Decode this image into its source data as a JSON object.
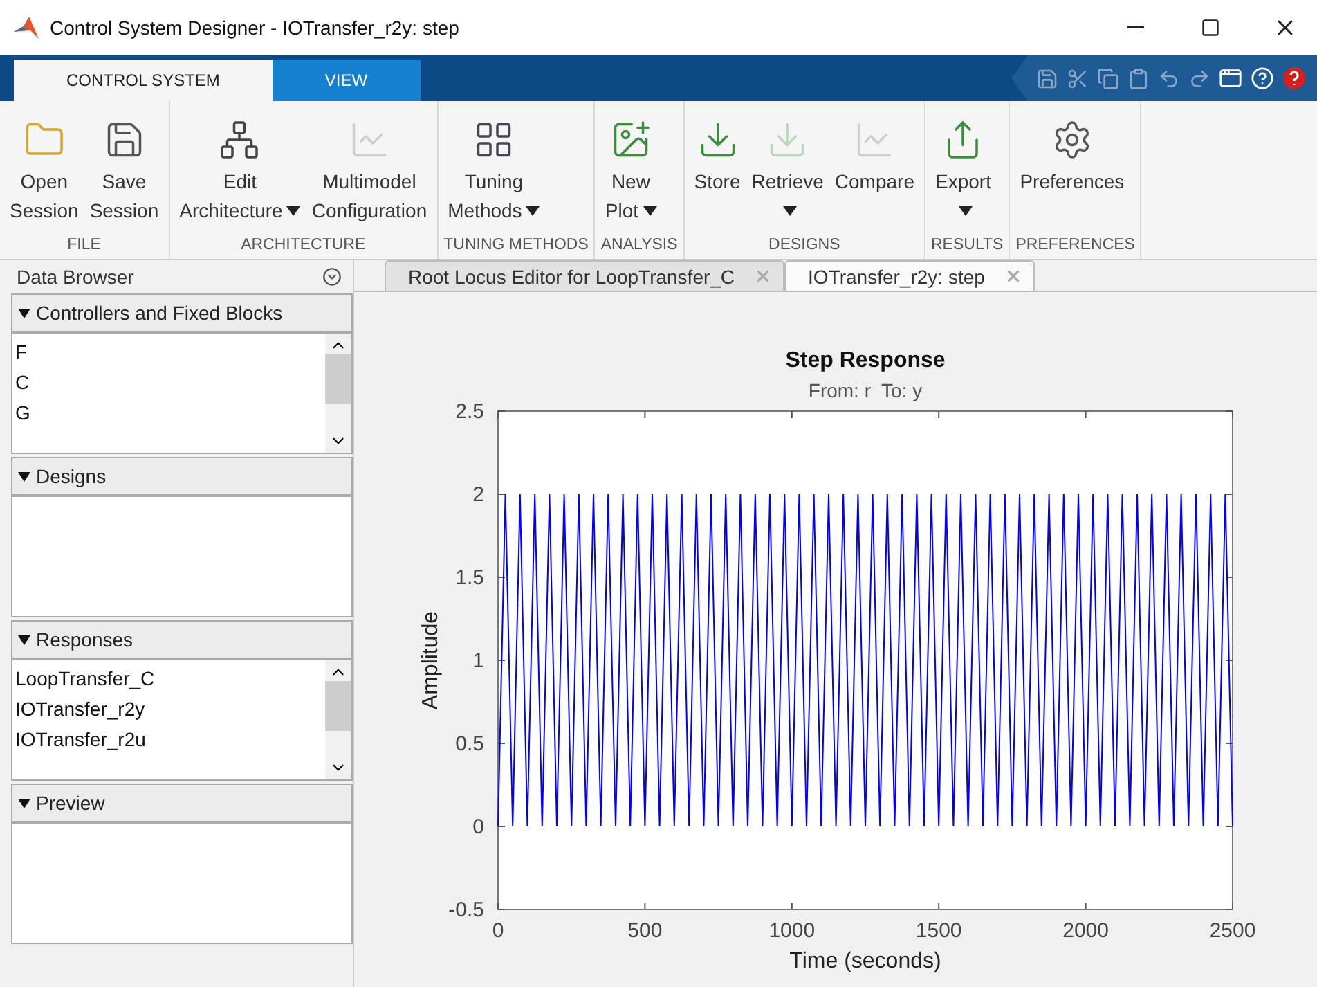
{
  "window": {
    "title": "Control System Designer - IOTransfer_r2y: step"
  },
  "ribbon_tabs": [
    {
      "label": "CONTROL SYSTEM",
      "selected": true
    },
    {
      "label": "VIEW",
      "selected": false
    }
  ],
  "ribbon_groups": [
    {
      "label": "FILE",
      "buttons": [
        {
          "lines": [
            "Open",
            "Session"
          ],
          "kind": "folder",
          "disabled": false,
          "dropdown": false
        },
        {
          "lines": [
            "Save",
            "Session"
          ],
          "kind": "save",
          "disabled": false,
          "dropdown": false
        }
      ]
    },
    {
      "label": "ARCHITECTURE",
      "buttons": [
        {
          "lines": [
            "Edit",
            "Architecture"
          ],
          "kind": "blocks",
          "disabled": false,
          "dropdown": true
        },
        {
          "lines": [
            "Multimodel",
            "Configuration"
          ],
          "kind": "chart",
          "disabled": true,
          "dropdown": false
        }
      ]
    },
    {
      "label": "TUNING METHODS",
      "buttons": [
        {
          "lines": [
            "Tuning",
            "Methods"
          ],
          "kind": "grid",
          "disabled": false,
          "dropdown": true
        }
      ]
    },
    {
      "label": "ANALYSIS",
      "buttons": [
        {
          "lines": [
            "New",
            "Plot"
          ],
          "kind": "newplot",
          "disabled": false,
          "dropdown": true
        }
      ]
    },
    {
      "label": "DESIGNS",
      "buttons": [
        {
          "lines": [
            "Store"
          ],
          "kind": "store",
          "disabled": false,
          "dropdown": false
        },
        {
          "lines": [
            "Retrieve"
          ],
          "kind": "store",
          "disabled": true,
          "dropdown": true
        },
        {
          "lines": [
            "Compare"
          ],
          "kind": "chart",
          "disabled": true,
          "dropdown": false
        }
      ]
    },
    {
      "label": "RESULTS",
      "buttons": [
        {
          "lines": [
            "Export"
          ],
          "kind": "export",
          "disabled": false,
          "dropdown": true
        }
      ]
    },
    {
      "label": "PREFERENCES",
      "buttons": [
        {
          "lines": [
            "Preferences"
          ],
          "kind": "gear",
          "disabled": false,
          "dropdown": false
        }
      ]
    }
  ],
  "data_browser": {
    "title": "Data Browser",
    "sections": [
      {
        "title": "Controllers and Fixed Blocks",
        "expanded": true,
        "items": [
          "F",
          "C",
          "G"
        ],
        "scrollable": true
      },
      {
        "title": "Designs",
        "expanded": true,
        "scrollable": false
      },
      {
        "title": "Responses",
        "expanded": true,
        "items": [
          "LoopTransfer_C",
          "IOTransfer_r2y",
          "IOTransfer_r2u"
        ],
        "scrollable": true
      },
      {
        "title": "Preview",
        "expanded": true,
        "scrollable": false
      }
    ]
  },
  "document_tabs": [
    {
      "label": "Root Locus Editor for LoopTransfer_C",
      "selected": false
    },
    {
      "label": "IOTransfer_r2y: step",
      "selected": true
    }
  ],
  "plot": {
    "subtitle": "From: r  To: y",
    "chart_data": {
      "type": "line",
      "title": "Step Response",
      "xlabel": "Time (seconds)",
      "ylabel": "Amplitude",
      "xlim": [
        0,
        2500
      ],
      "ylim": [
        -0.5,
        2.5
      ],
      "xticks": [
        0,
        500,
        1000,
        1500,
        2000,
        2500
      ],
      "yticks": [
        -0.5,
        0,
        0.5,
        1,
        1.5,
        2,
        2.5
      ],
      "x": [
        0,
        25,
        50,
        75,
        100,
        125,
        150,
        175,
        200,
        225,
        250,
        275,
        300,
        325,
        350,
        375,
        400,
        425,
        450,
        475,
        500,
        525,
        550,
        575,
        600,
        625,
        650,
        675,
        700,
        725,
        750,
        775,
        800,
        825,
        850,
        875,
        900,
        925,
        950,
        975,
        1000,
        1025,
        1050,
        1075,
        1100,
        1125,
        1150,
        1175,
        1200,
        1225,
        1250,
        1275,
        1300,
        1325,
        1350,
        1375,
        1400,
        1425,
        1450,
        1475,
        1500,
        1525,
        1550,
        1575,
        1600,
        1625,
        1650,
        1675,
        1700,
        1725,
        1750,
        1775,
        1800,
        1825,
        1850,
        1875,
        1900,
        1925,
        1950,
        1975,
        2000,
        2025,
        2050,
        2075,
        2100,
        2125,
        2150,
        2175,
        2200,
        2225,
        2250,
        2275,
        2300,
        2325,
        2350,
        2375,
        2400,
        2425,
        2450,
        2475,
        2500
      ],
      "series": [
        {
          "color": "#0000ff",
          "values": [
            0,
            2,
            0,
            2,
            0,
            2,
            0,
            2,
            0,
            2,
            0,
            2,
            0,
            2,
            0,
            2,
            0,
            2,
            0,
            2,
            0,
            2,
            0,
            2,
            0,
            2,
            0,
            2,
            0,
            2,
            0,
            2,
            0,
            2,
            0,
            2,
            0,
            2,
            0,
            2,
            0,
            2,
            0,
            2,
            0,
            2,
            0,
            2,
            0,
            2,
            0,
            2,
            0,
            2,
            0,
            2,
            0,
            2,
            0,
            2,
            0,
            2,
            0,
            2,
            0,
            2,
            0,
            2,
            0,
            2,
            0,
            2,
            0,
            2,
            0,
            2,
            0,
            2,
            0,
            2,
            0,
            2,
            0,
            2,
            0,
            2,
            0,
            2,
            0,
            2,
            0,
            2,
            0,
            2,
            0,
            2,
            0,
            2,
            0,
            2,
            0
          ]
        }
      ]
    }
  }
}
